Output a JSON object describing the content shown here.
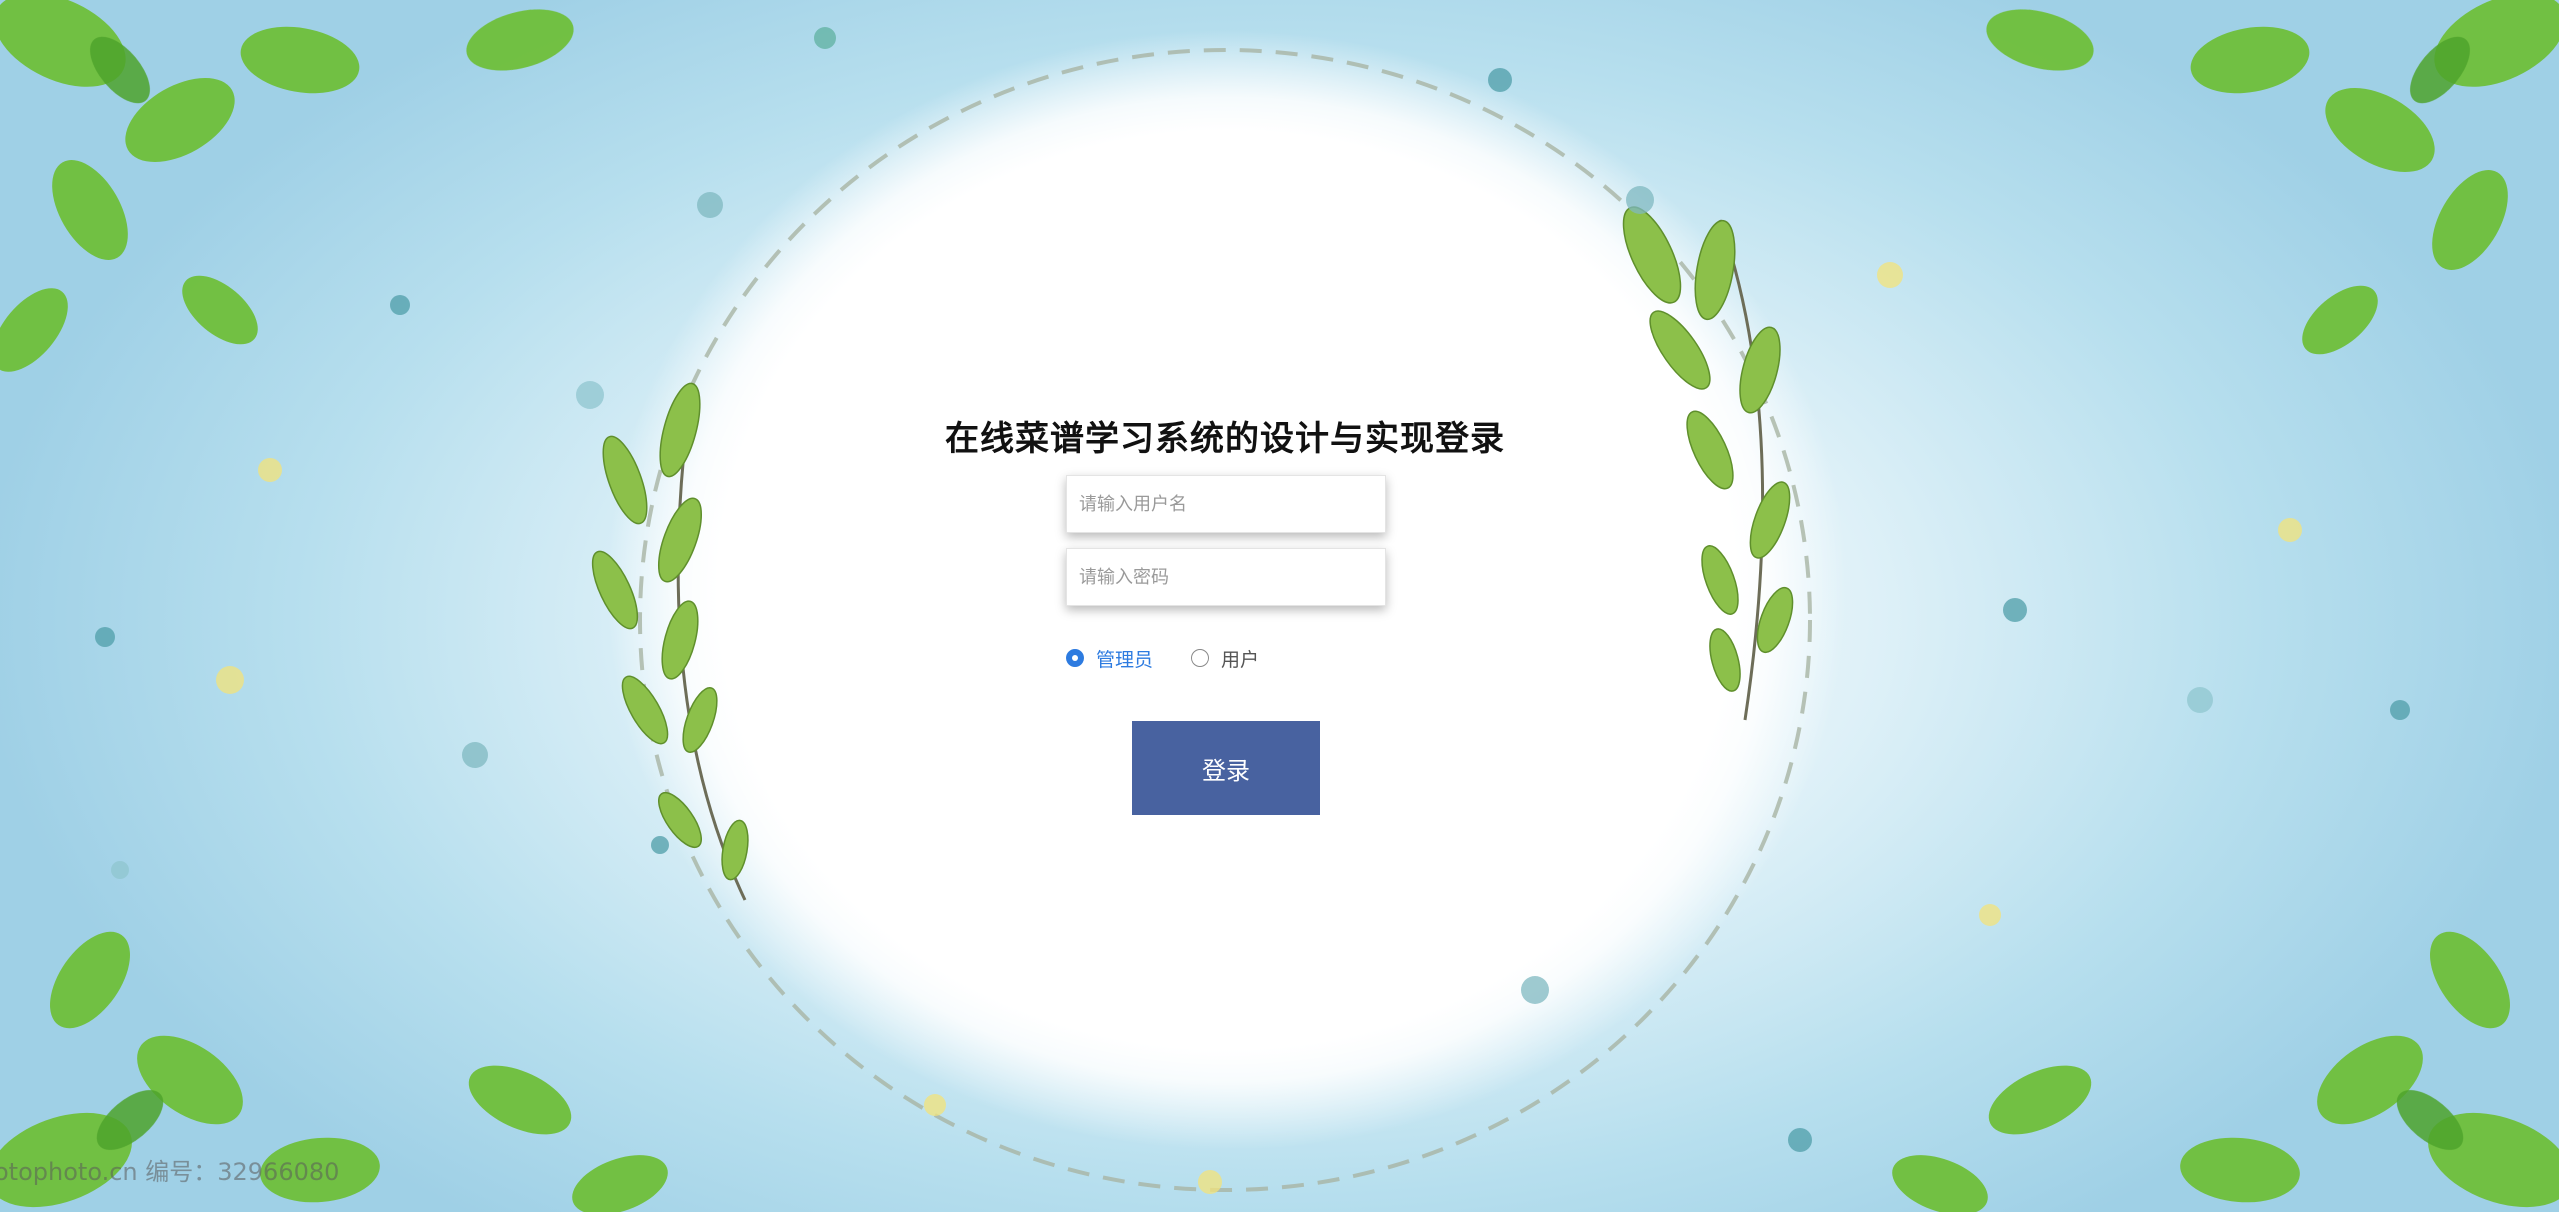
{
  "page": {
    "title": "在线菜谱学习系统的设计与实现登录"
  },
  "login_form": {
    "username_placeholder": "请输入用户名",
    "password_placeholder": "请输入密码",
    "roles": [
      {
        "label": "管理员",
        "selected": true
      },
      {
        "label": "用户",
        "selected": false
      }
    ],
    "submit_label": "登录"
  },
  "watermark": "otophoto.cn  编号：32966080",
  "colors": {
    "accent": "#2d7be0",
    "button": "#4862a0",
    "leaf": "#7cbf3a"
  }
}
